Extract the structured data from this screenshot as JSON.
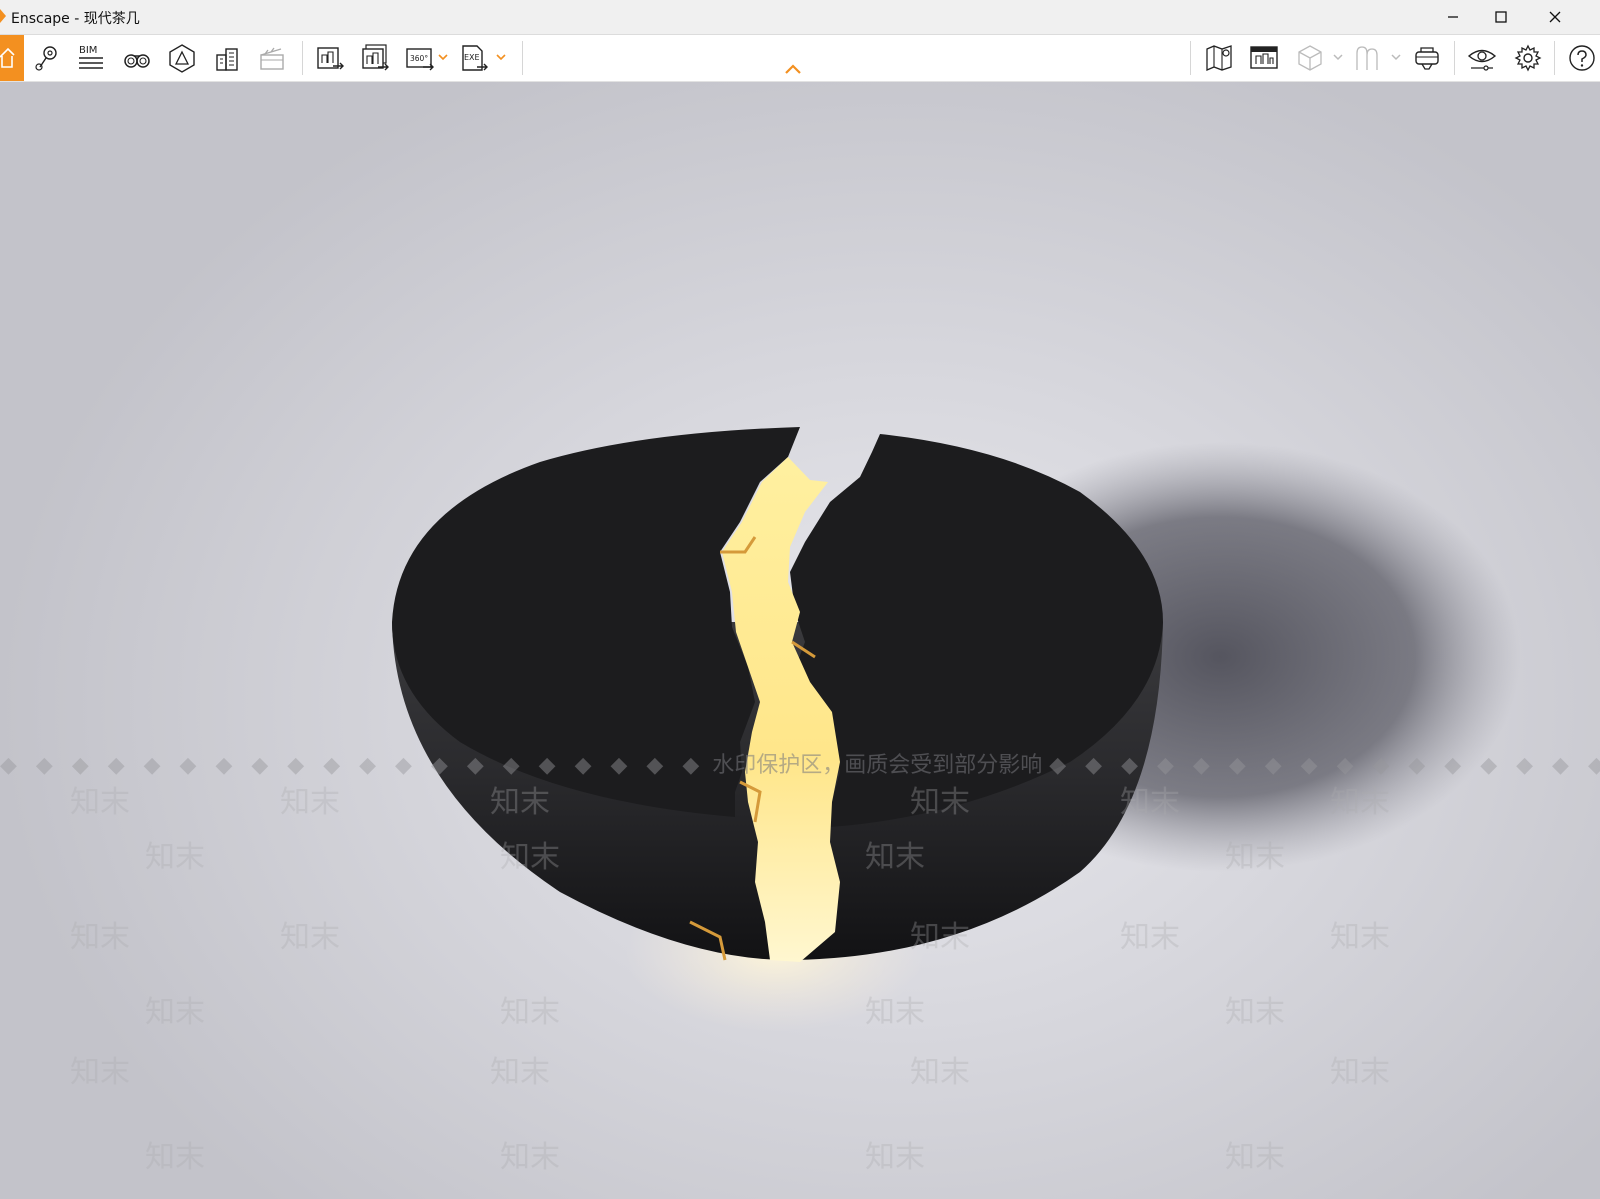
{
  "window": {
    "title": "Enscape - 现代茶几",
    "minimize": "minimize",
    "maximize": "maximize",
    "close": "close"
  },
  "toolbar": {
    "bim_label": "BIM",
    "pano_label": "360°",
    "exe_label": "EXE",
    "icons": [
      "home-icon",
      "map-pin-icon",
      "bim-icon",
      "binoculars-icon",
      "perspective-icon",
      "building-icon",
      "clapper-icon",
      "render-image-icon",
      "batch-render-icon",
      "panorama-icon",
      "export-exe-icon",
      "map-icon",
      "asset-library-icon",
      "cube-icon",
      "person-icon",
      "vr-headset-icon",
      "eye-icon",
      "settings-icon",
      "help-icon"
    ],
    "accent": "#f39020"
  },
  "watermark": {
    "banner": "水印保护区，画质会受到部分影响",
    "tile": "知末"
  },
  "scene": {
    "object": "cracked black half-sphere coffee table with glowing gold fissure",
    "table_color": "#1e1e20",
    "glow_color": "#fff2b0"
  }
}
